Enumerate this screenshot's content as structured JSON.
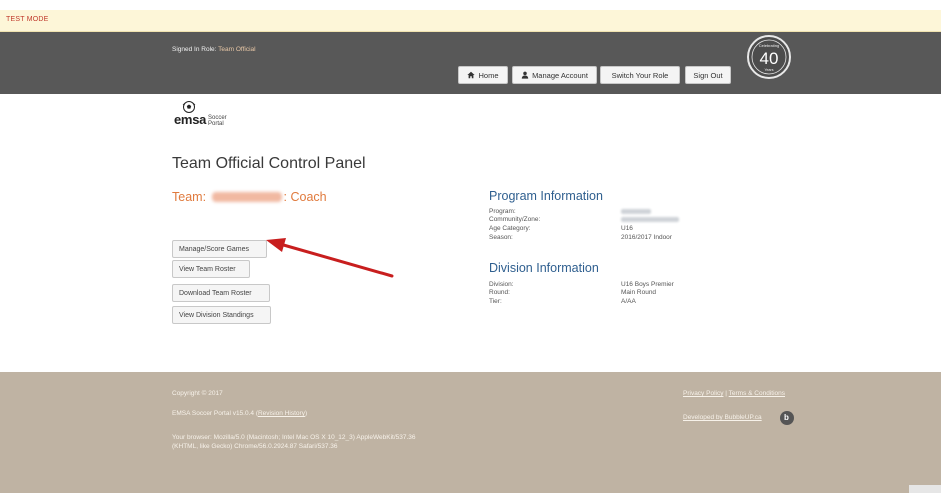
{
  "test_mode": "TEST MODE",
  "header": {
    "role_label": "Signed In Role:",
    "role_value": "Team Official",
    "nav": {
      "home": "Home",
      "manage_account": "Manage Account",
      "switch_role": "Switch Your Role",
      "sign_out": "Sign Out"
    },
    "badge": {
      "top": "Celebrating",
      "number": "40",
      "bottom": "Years"
    }
  },
  "logo": {
    "mark": "emsa",
    "line1": "Soccer",
    "line2": "Portal"
  },
  "page_title": "Team Official Control Panel",
  "team": {
    "prefix": "Team:",
    "suffix": ": Coach"
  },
  "actions": {
    "manage_score": "Manage/Score Games",
    "view_roster": "View Team Roster",
    "download_roster": "Download Team Roster",
    "view_standings": "View Division Standings"
  },
  "program": {
    "heading": "Program Information",
    "program_label": "Program:",
    "community_label": "Community/Zone:",
    "age_label": "Age Category:",
    "age_value": "U16",
    "season_label": "Season:",
    "season_value": "2016/2017 Indoor"
  },
  "division": {
    "heading": "Division Information",
    "division_label": "Division:",
    "division_value": "U16 Boys Premier",
    "round_label": "Round:",
    "round_value": "Main Round",
    "tier_label": "Tier:",
    "tier_value": "A/AA"
  },
  "footer": {
    "copyright": "Copyright © 2017",
    "version_text": "EMSA Soccer Portal v15.0.4 (",
    "revision_link": "Revision History",
    "version_close": ")",
    "browser_line1": "Your browser: Mozilla/5.0 (Macintosh; Intel Mac OS X 10_12_3) AppleWebKit/537.36",
    "browser_line2": "(KHTML, like Gecko) Chrome/56.0.2924.87 Safari/537.36",
    "privacy": "Privacy Policy",
    "sep": " | ",
    "terms": "Terms & Conditions",
    "developed": "Developed by BubbleUP.ca"
  },
  "colors": {
    "header_bg": "#585858",
    "footer_bg": "#bfb3a3",
    "team_orange": "#e07a3d",
    "section_blue": "#2f5f8f",
    "arrow_red": "#c81e1e"
  },
  "icons": [
    "home-icon",
    "user-icon",
    "soccer-ball-icon",
    "arrow-annotation",
    "bubbleup-logo-icon"
  ]
}
